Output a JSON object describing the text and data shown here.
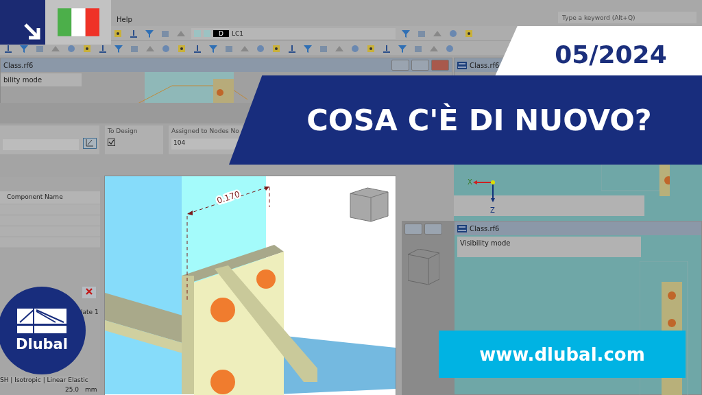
{
  "menu": {
    "items": [
      "Help"
    ]
  },
  "search": {
    "placeholder": "Type a keyword (Alt+Q)"
  },
  "load_case": {
    "badge": "D",
    "name": "LC1"
  },
  "windows": [
    {
      "title": "Class.rf6",
      "info": "bility mode"
    },
    {
      "title": "Class.rf6"
    },
    {
      "title": "Class.rf6",
      "info": "Visibility mode"
    }
  ],
  "form": {
    "fields": [
      {
        "kind": "text"
      },
      {
        "kind": "checkbox",
        "label": "To Design",
        "checked": true
      },
      {
        "kind": "text",
        "label": "Assigned to Nodes No",
        "value": "104"
      }
    ]
  },
  "table": {
    "header": "Component Name",
    "section": "late 1",
    "material": "SH | Isotropic | Linear Elastic",
    "thickness": "25.0",
    "unit": "mm"
  },
  "model_view": {
    "dimension": "0.170"
  },
  "axes": {
    "x": "X",
    "z": "Z"
  },
  "promo": {
    "date": "05/2024",
    "headline": "COSA C'È DI NUOVO?",
    "url": "www.dlubal.com",
    "logo": "Dlubal"
  }
}
